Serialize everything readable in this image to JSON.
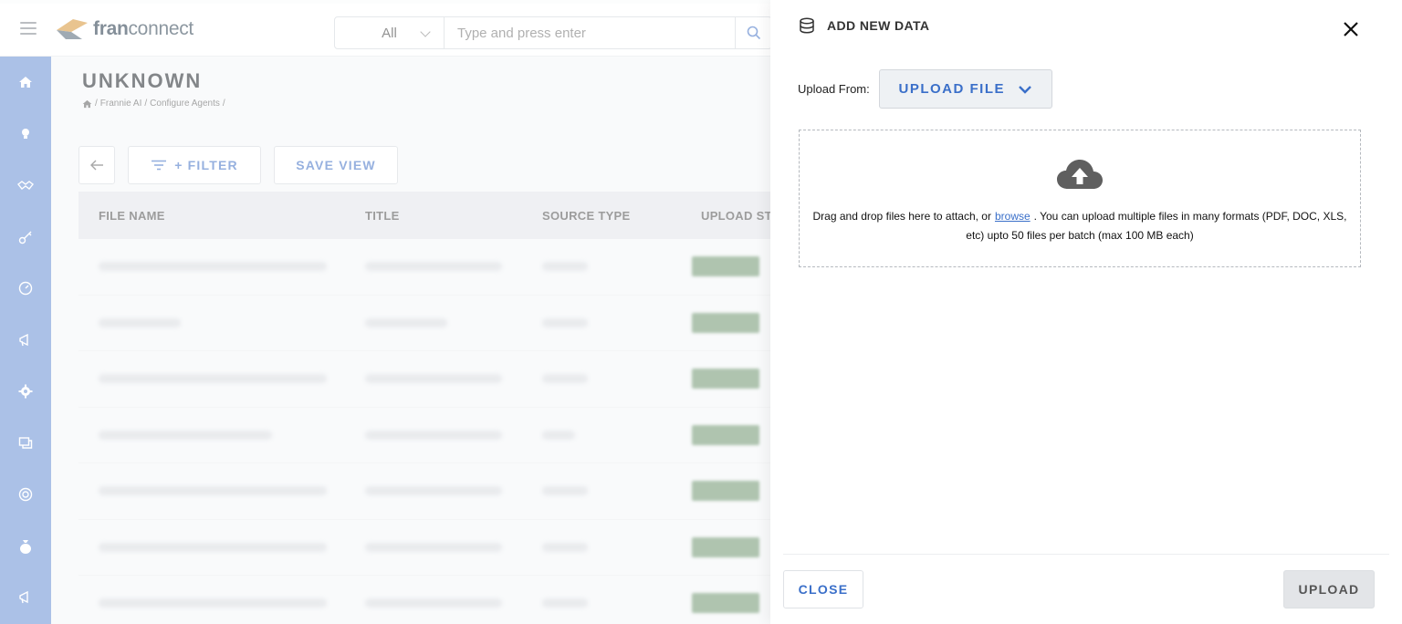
{
  "app": {
    "logo_text_a": "fran",
    "logo_text_b": "connect",
    "search": {
      "scope": "All",
      "placeholder": "Type and press enter"
    },
    "nav_icons": [
      "home-icon",
      "lightbulb-icon",
      "handshake-icon",
      "key-icon",
      "speedometer-icon",
      "megaphone-icon",
      "gear-icon",
      "chat-icon",
      "lifebuoy-icon",
      "money-bag-icon",
      "megaphone-icon"
    ],
    "page_title": "UNKNOWN",
    "breadcrumb": [
      "Frannie AI",
      "Configure Agents"
    ],
    "toolbar": {
      "filter_label": "+ FILTER",
      "save_view_label": "SAVE VIEW"
    },
    "table": {
      "columns": [
        "FILE NAME",
        "TITLE",
        "SOURCE TYPE",
        "UPLOAD ST"
      ],
      "row_count": 7
    }
  },
  "drawer": {
    "title": "ADD NEW DATA",
    "upload_from_label": "Upload From:",
    "upload_from_value": "UPLOAD FILE",
    "dropzone": {
      "text_before": "Drag and drop files here to attach, or",
      "browse_link": "browse",
      "text_after": ". You can upload multiple files in many formats (PDF, DOC, XLS, etc) upto 50 files per batch (max 100 MB each)"
    },
    "close_label": "CLOSE",
    "upload_label": "UPLOAD"
  },
  "colors": {
    "accent": "#3a6fc9",
    "sidenav": "#6f95d6",
    "status_chip": "#5f8a5f"
  }
}
